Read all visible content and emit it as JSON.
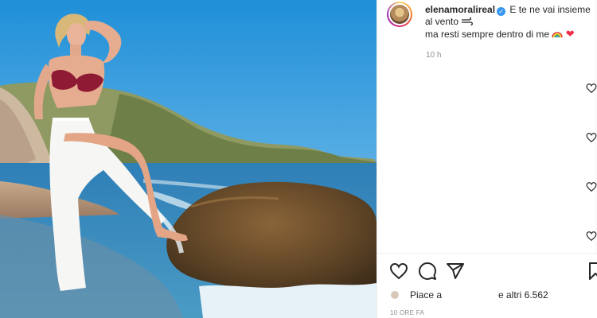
{
  "post": {
    "username": "elenamoralireal",
    "verified_mark": "✓",
    "caption_line1": "E te ne vai insieme",
    "caption_line2": "al vento",
    "caption_line3": "ma resti sempre dentro di me",
    "caption_emoji_heart": "❤",
    "caption_time": "10 h",
    "likes_label": "Piace a",
    "likes_count": "e altri 6.562",
    "post_date": "10 ORE FA"
  },
  "icons": {
    "avatar": "profile-avatar",
    "verified": "verified-badge-icon",
    "wind": "wind-icon",
    "rainbow": "rainbow-icon",
    "heart": "heart-icon",
    "comment": "comment-icon",
    "share": "share-icon",
    "save": "bookmark-icon",
    "comment_like": "heart-outline-icon"
  },
  "colors": {
    "text": "#262626",
    "secondary": "#8e8e8e",
    "verified": "#3897f0",
    "divider": "#efefef"
  }
}
